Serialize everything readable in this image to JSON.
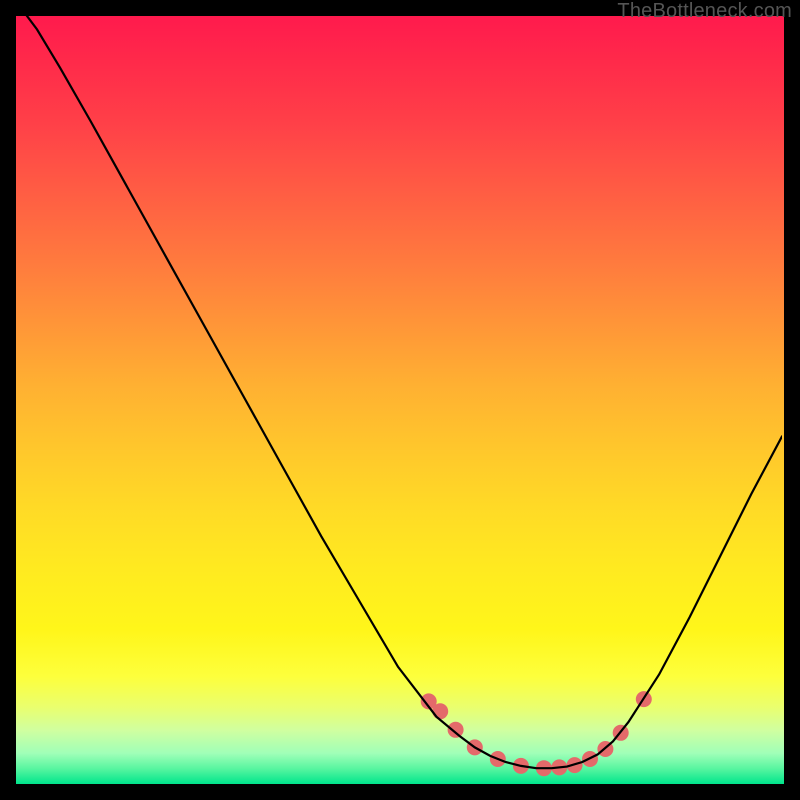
{
  "watermark": "TheBottleneck.com",
  "chart_data": {
    "type": "line",
    "title": "",
    "xlabel": "",
    "ylabel": "",
    "xlim": [
      0,
      100
    ],
    "ylim": [
      0,
      100
    ],
    "grid": false,
    "legend": false,
    "series": [
      {
        "name": "bottleneck-curve",
        "x": [
          0,
          3,
          6,
          10,
          15,
          20,
          25,
          30,
          35,
          40,
          45,
          50,
          55,
          58,
          60,
          62,
          64,
          66,
          68,
          70,
          72,
          74,
          76,
          78,
          80,
          84,
          88,
          92,
          96,
          100
        ],
        "y": [
          102,
          98,
          93,
          86,
          77,
          68,
          59,
          50,
          41,
          32,
          23.5,
          15,
          8.5,
          6,
          4.5,
          3.4,
          2.6,
          2.1,
          1.8,
          1.8,
          2.0,
          2.6,
          3.6,
          5.3,
          7.8,
          14,
          21.5,
          29.5,
          37.5,
          45
        ]
      }
    ],
    "markers": {
      "name": "highlight-dots",
      "color": "#e46a6a",
      "x": [
        54,
        55.5,
        57.5,
        60,
        63,
        66,
        69,
        71,
        73,
        75,
        77,
        79,
        82
      ],
      "y": [
        10.5,
        9.2,
        6.8,
        4.5,
        3.0,
        2.1,
        1.8,
        1.9,
        2.2,
        3.0,
        4.3,
        6.4,
        10.8
      ]
    },
    "gradient_bands": [
      {
        "name": "critical-red",
        "approx_y_start": 70,
        "approx_y_end": 100
      },
      {
        "name": "warning-orange",
        "approx_y_start": 35,
        "approx_y_end": 70
      },
      {
        "name": "caution-yellow",
        "approx_y_start": 8,
        "approx_y_end": 35
      },
      {
        "name": "optimal-green",
        "approx_y_start": 0,
        "approx_y_end": 8
      }
    ]
  }
}
